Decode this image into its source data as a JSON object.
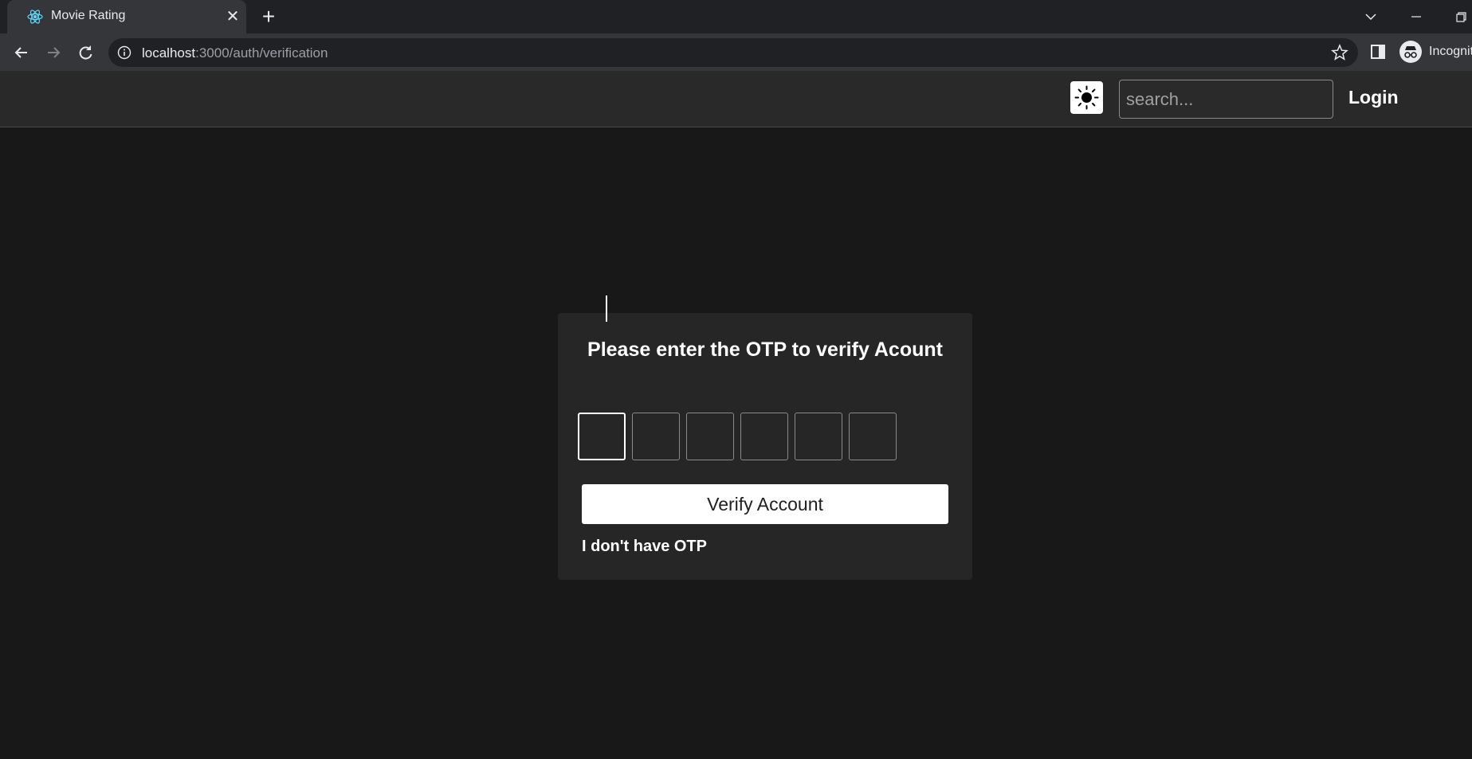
{
  "browser": {
    "tab": {
      "title": "Movie Rating",
      "favicon": "react-icon"
    },
    "address_bar": {
      "host": "localhost",
      "path": ":3000/auth/verification"
    },
    "profile_label": "Incognito"
  },
  "header": {
    "theme_toggle_icon": "sun-icon",
    "search": {
      "placeholder": "search...",
      "value": ""
    },
    "login_label": "Login"
  },
  "verification": {
    "title": "Please enter the OTP to verify Acount",
    "otp_digits": [
      "",
      "",
      "",
      "",
      "",
      ""
    ],
    "verify_label": "Verify Account",
    "no_otp_label": "I don't have OTP"
  },
  "colors": {
    "page_bg": "#181818",
    "header_bg": "#292929",
    "card_bg": "#262626",
    "button_bg": "#ffffff",
    "text": "#ffffff"
  }
}
